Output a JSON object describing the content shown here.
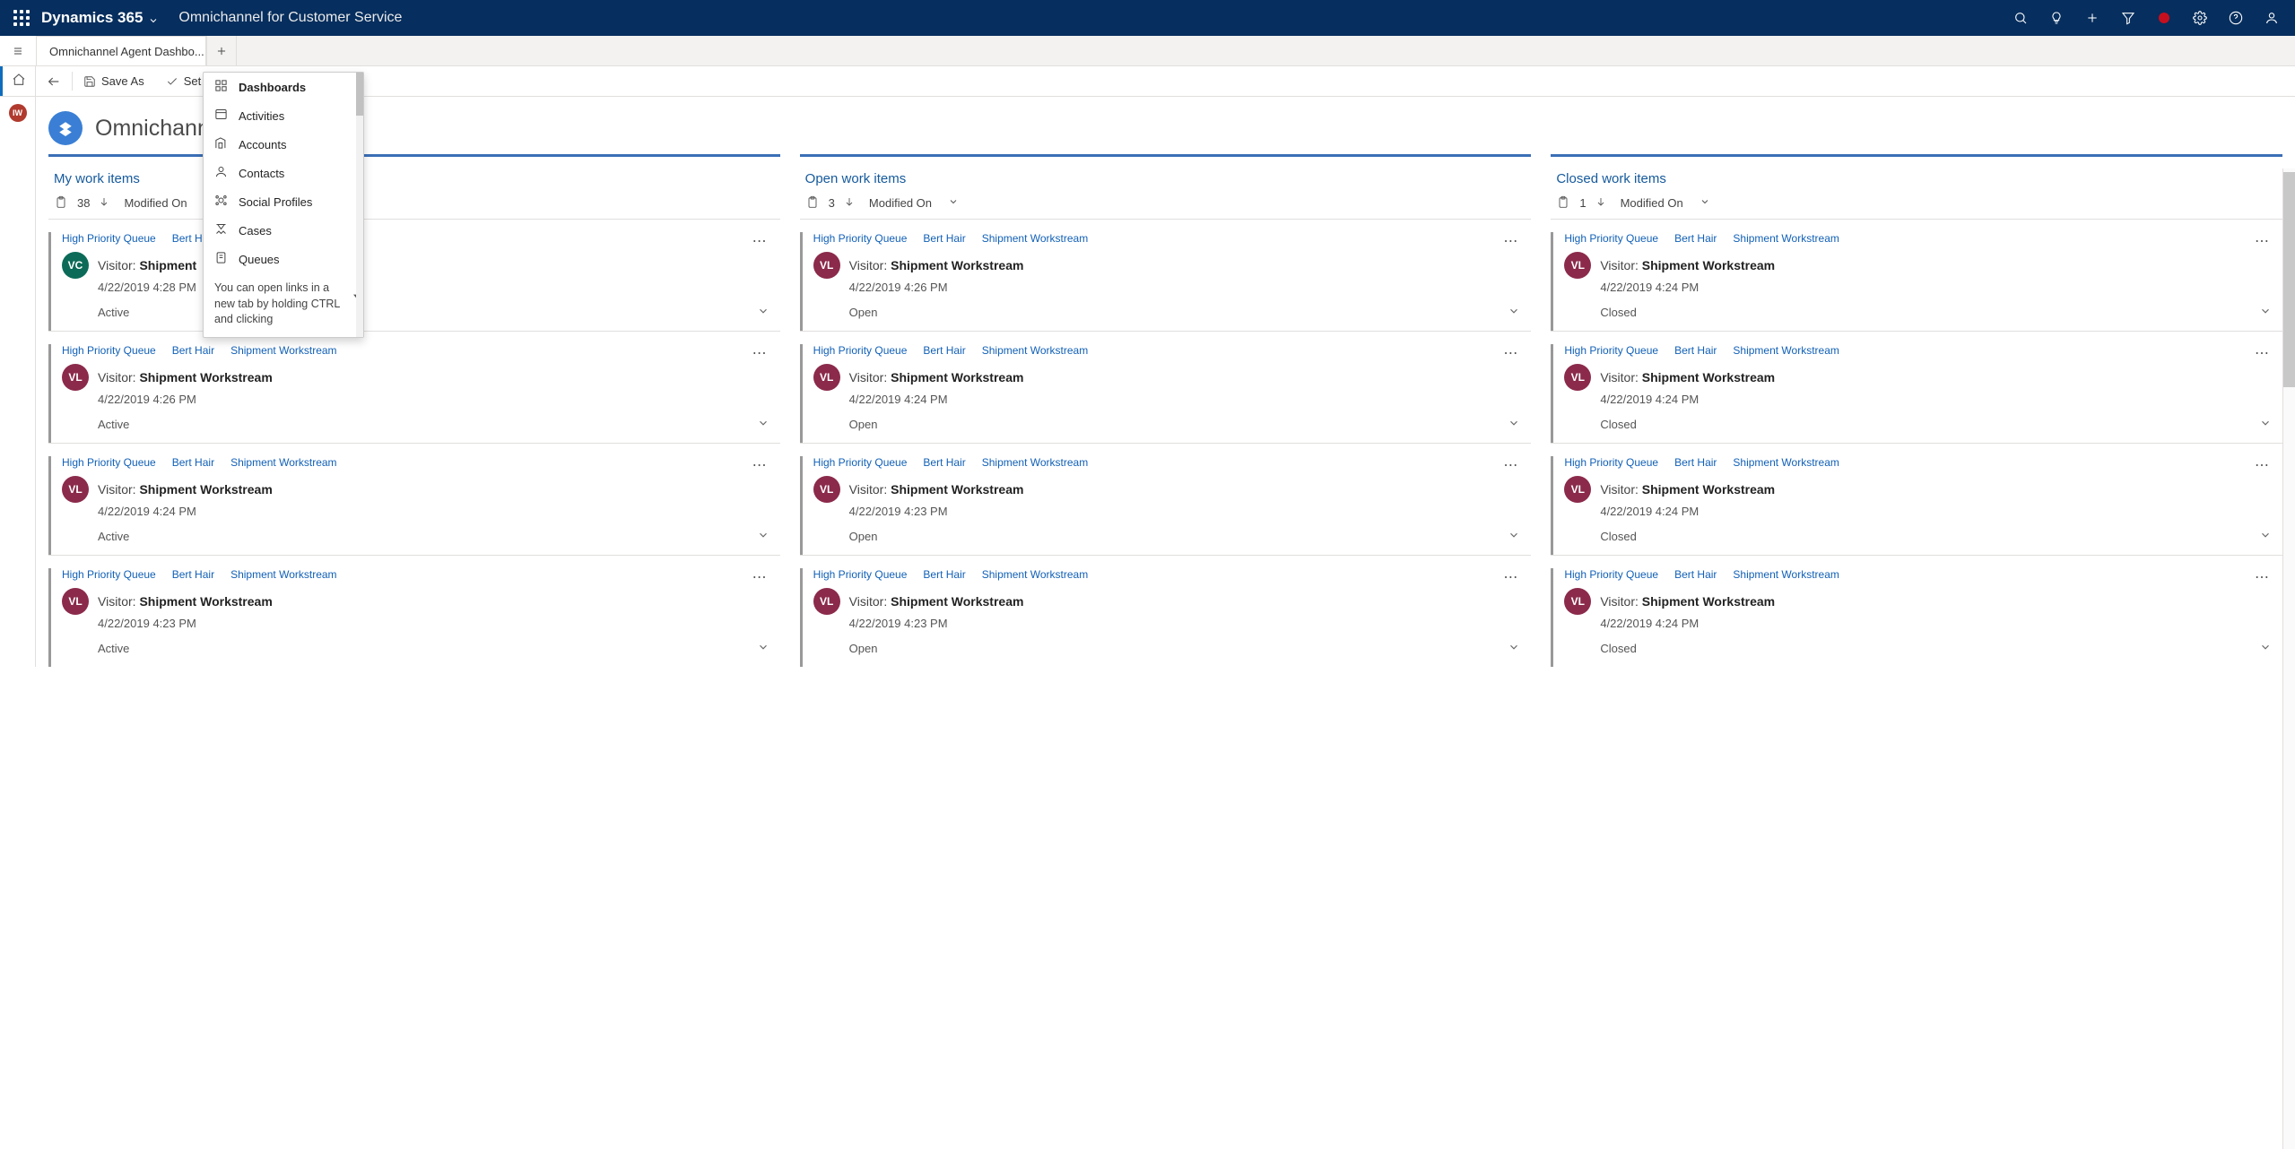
{
  "topbar": {
    "brand": "Dynamics 365",
    "app": "Omnichannel for Customer Service"
  },
  "topbar_icons": [
    "search",
    "lightbulb",
    "plus",
    "filter",
    "record",
    "settings",
    "help",
    "account"
  ],
  "tab": {
    "label": "Omnichannel Agent Dashbo..."
  },
  "commands": {
    "save_as": "Save As",
    "set_default": "Set As D"
  },
  "page": {
    "title": "Omnichannel"
  },
  "presence_initials": "IW",
  "menu": {
    "items": [
      "Dashboards",
      "Activities",
      "Accounts",
      "Contacts",
      "Social Profiles",
      "Cases",
      "Queues"
    ],
    "tip": "You can open links in a new tab by holding CTRL and clicking"
  },
  "columns": [
    {
      "title": "My work items",
      "count": "38",
      "sort": "Modified On",
      "cards": [
        {
          "crumbs": [
            "High Priority Queue",
            "Bert Hair"
          ],
          "avatar": "VC",
          "avatarClass": "av-teal",
          "visitor": "Shipment",
          "date": "4/22/2019 4:28 PM",
          "status": "Active"
        },
        {
          "crumbs": [
            "High Priority Queue",
            "Bert Hair",
            "Shipment Workstream"
          ],
          "avatar": "VL",
          "avatarClass": "av-maroon",
          "visitor": "Shipment Workstream",
          "date": "4/22/2019 4:26 PM",
          "status": "Active"
        },
        {
          "crumbs": [
            "High Priority Queue",
            "Bert Hair",
            "Shipment Workstream"
          ],
          "avatar": "VL",
          "avatarClass": "av-maroon",
          "visitor": "Shipment Workstream",
          "date": "4/22/2019 4:24 PM",
          "status": "Active"
        },
        {
          "crumbs": [
            "High Priority Queue",
            "Bert Hair",
            "Shipment Workstream"
          ],
          "avatar": "VL",
          "avatarClass": "av-maroon",
          "visitor": "Shipment Workstream",
          "date": "4/22/2019 4:23 PM",
          "status": "Active"
        }
      ]
    },
    {
      "title": "Open work items",
      "count": "3",
      "sort": "Modified On",
      "cards": [
        {
          "crumbs": [
            "High Priority Queue",
            "Bert Hair",
            "Shipment Workstream"
          ],
          "avatar": "VL",
          "avatarClass": "av-maroon",
          "visitor": "Shipment Workstream",
          "date": "4/22/2019 4:26 PM",
          "status": "Open"
        },
        {
          "crumbs": [
            "High Priority Queue",
            "Bert Hair",
            "Shipment Workstream"
          ],
          "avatar": "VL",
          "avatarClass": "av-maroon",
          "visitor": "Shipment Workstream",
          "date": "4/22/2019 4:24 PM",
          "status": "Open"
        },
        {
          "crumbs": [
            "High Priority Queue",
            "Bert Hair",
            "Shipment Workstream"
          ],
          "avatar": "VL",
          "avatarClass": "av-maroon",
          "visitor": "Shipment Workstream",
          "date": "4/22/2019 4:23 PM",
          "status": "Open"
        },
        {
          "crumbs": [
            "High Priority Queue",
            "Bert Hair",
            "Shipment Workstream"
          ],
          "avatar": "VL",
          "avatarClass": "av-maroon",
          "visitor": "Shipment Workstream",
          "date": "4/22/2019 4:23 PM",
          "status": "Open"
        }
      ]
    },
    {
      "title": "Closed work items",
      "count": "1",
      "sort": "Modified On",
      "cards": [
        {
          "crumbs": [
            "High Priority Queue",
            "Bert Hair",
            "Shipment Workstream"
          ],
          "avatar": "VL",
          "avatarClass": "av-maroon",
          "visitor": "Shipment Workstream",
          "date": "4/22/2019 4:24 PM",
          "status": "Closed"
        },
        {
          "crumbs": [
            "High Priority Queue",
            "Bert Hair",
            "Shipment Workstream"
          ],
          "avatar": "VL",
          "avatarClass": "av-maroon",
          "visitor": "Shipment Workstream",
          "date": "4/22/2019 4:24 PM",
          "status": "Closed"
        },
        {
          "crumbs": [
            "High Priority Queue",
            "Bert Hair",
            "Shipment Workstream"
          ],
          "avatar": "VL",
          "avatarClass": "av-maroon",
          "visitor": "Shipment Workstream",
          "date": "4/22/2019 4:24 PM",
          "status": "Closed"
        },
        {
          "crumbs": [
            "High Priority Queue",
            "Bert Hair",
            "Shipment Workstream"
          ],
          "avatar": "VL",
          "avatarClass": "av-maroon",
          "visitor": "Shipment Workstream",
          "date": "4/22/2019 4:24 PM",
          "status": "Closed"
        }
      ]
    }
  ],
  "visitor_label": "Visitor:"
}
